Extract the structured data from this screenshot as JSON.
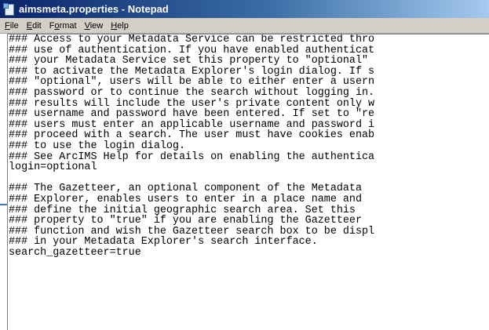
{
  "window": {
    "title": "aimsmeta.properties - Notepad",
    "app_icon": "notepad-icon",
    "accent_color": "#0a246a"
  },
  "menu": {
    "items": [
      {
        "accel": "F",
        "rest": "ile"
      },
      {
        "accel": "E",
        "rest": "dit"
      },
      {
        "pre": "F",
        "accel": "o",
        "rest": "rmat"
      },
      {
        "accel": "V",
        "rest": "iew"
      },
      {
        "accel": "H",
        "rest": "elp"
      }
    ]
  },
  "editor": {
    "lines": [
      "### Access to your Metadata Service can be restricted thro",
      "### use of authentication. If you have enabled authenticat",
      "### your Metadata Service set this property to \"optional\" ",
      "### to activate the Metadata Explorer's login dialog. If s",
      "### \"optional\", users will be able to either enter a usern",
      "### password or to continue the search without logging in.",
      "### results will include the user's private content only w",
      "### username and password have been entered. If set to \"re",
      "### users must enter an applicable username and password i",
      "### proceed with a search. The user must have cookies enab",
      "### to use the login dialog.",
      "### See ArcIMS Help for details on enabling the authentica",
      "login=optional",
      "",
      "### The Gazetteer, an optional component of the Metadata",
      "### Explorer, enables users to enter in a place name and",
      "### define the initial geographic search area. Set this",
      "### property to \"true\" if you are enabling the Gazetteer",
      "### function and wish the Gazetteer search box to be displ",
      "### in your Metadata Explorer's search interface.",
      "search_gazetteer=true"
    ]
  }
}
